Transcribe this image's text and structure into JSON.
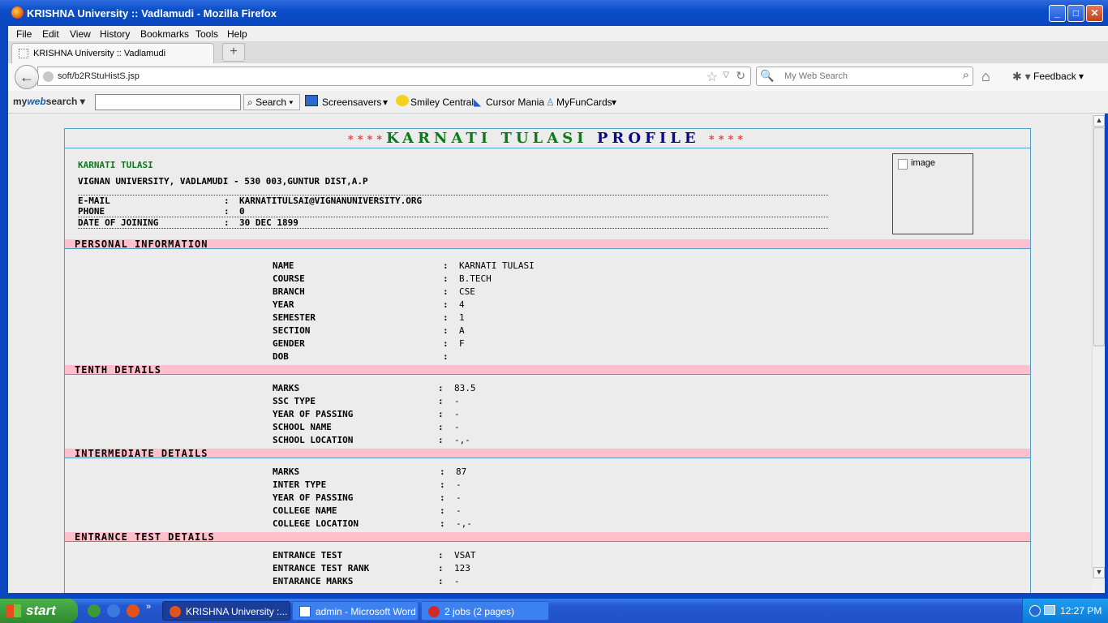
{
  "window": {
    "title": "KRISHNA University :: Vadlamudi - Mozilla Firefox",
    "minimize": "_",
    "maximize": "□",
    "close": "✕"
  },
  "menu": [
    "File",
    "Edit",
    "View",
    "History",
    "Bookmarks",
    "Tools",
    "Help"
  ],
  "tab": {
    "label": "KRISHNA University :: Vadlamudi",
    "new_tab": "+"
  },
  "nav": {
    "url": "soft/b2RStuHistS.jsp",
    "search_placeholder": "My Web Search",
    "feedback": "Feedback"
  },
  "toolbar": {
    "brand_my": "my",
    "brand_web": "web",
    "brand_search": "search",
    "search_button": "Search",
    "items": [
      "Screensavers",
      "Smiley Central",
      "Cursor Mania",
      "MyFunCards"
    ]
  },
  "profile": {
    "header_stars": "****",
    "header_name": "KARNATI TULASI",
    "header_profile": "PROFILE",
    "name": "KARNATI TULASI",
    "address": "VIGNAN UNIVERSITY, VADLAMUDI - 530 003,GUNTUR DIST,A.P",
    "image_alt": "image",
    "contact": [
      {
        "label": "E-MAIL",
        "value": "KARNATITULSAI@VIGNANUNIVERSITY.ORG"
      },
      {
        "label": "PHONE",
        "value": "0"
      },
      {
        "label": "DATE OF JOINING",
        "value": "30 DEC 1899"
      }
    ],
    "colon": ":",
    "sections": {
      "personal": {
        "title": "PERSONAL INFORMATION",
        "rows": [
          {
            "label": "NAME",
            "value": "KARNATI TULASI"
          },
          {
            "label": "COURSE",
            "value": "B.TECH"
          },
          {
            "label": "BRANCH",
            "value": "CSE"
          },
          {
            "label": "YEAR",
            "value": "4"
          },
          {
            "label": "SEMESTER",
            "value": "1"
          },
          {
            "label": "SECTION",
            "value": "A"
          },
          {
            "label": "GENDER",
            "value": "F"
          },
          {
            "label": "DOB",
            "value": ""
          }
        ]
      },
      "tenth": {
        "title": "TENTH DETAILS",
        "rows": [
          {
            "label": "MARKS",
            "value": "83.5"
          },
          {
            "label": "SSC TYPE",
            "value": "-"
          },
          {
            "label": "YEAR OF PASSING",
            "value": "-"
          },
          {
            "label": "SCHOOL NAME",
            "value": "-"
          },
          {
            "label": "SCHOOL LOCATION",
            "value": "-,-"
          }
        ]
      },
      "intermediate": {
        "title": "INTERMEDIATE DETAILS",
        "rows": [
          {
            "label": "MARKS",
            "value": "87"
          },
          {
            "label": "INTER TYPE",
            "value": "-"
          },
          {
            "label": "YEAR OF PASSING",
            "value": "-"
          },
          {
            "label": "COLLEGE NAME",
            "value": "-"
          },
          {
            "label": "COLLEGE LOCATION",
            "value": "-,-"
          }
        ]
      },
      "entrance": {
        "title": "ENTRANCE TEST DETAILS",
        "rows": [
          {
            "label": "ENTRANCE TEST",
            "value": "VSAT"
          },
          {
            "label": "ENTRANCE TEST RANK",
            "value": "123"
          },
          {
            "label": "ENTARANCE MARKS",
            "value": "-"
          }
        ]
      }
    }
  },
  "taskbar": {
    "start": "start",
    "buttons": [
      {
        "label": "KRISHNA University :...",
        "active": true
      },
      {
        "label": "admin - Microsoft Word",
        "active": false
      },
      {
        "label": "2 jobs (2 pages)",
        "active": false
      }
    ],
    "clock": "12:27 PM"
  },
  "colors": {
    "section_bg": "#ffc0cb",
    "border_blue": "#4f9ec5",
    "name_green": "#0a7a1a",
    "profile_navy": "#0a0a8a",
    "star_red": "#d0403a"
  }
}
